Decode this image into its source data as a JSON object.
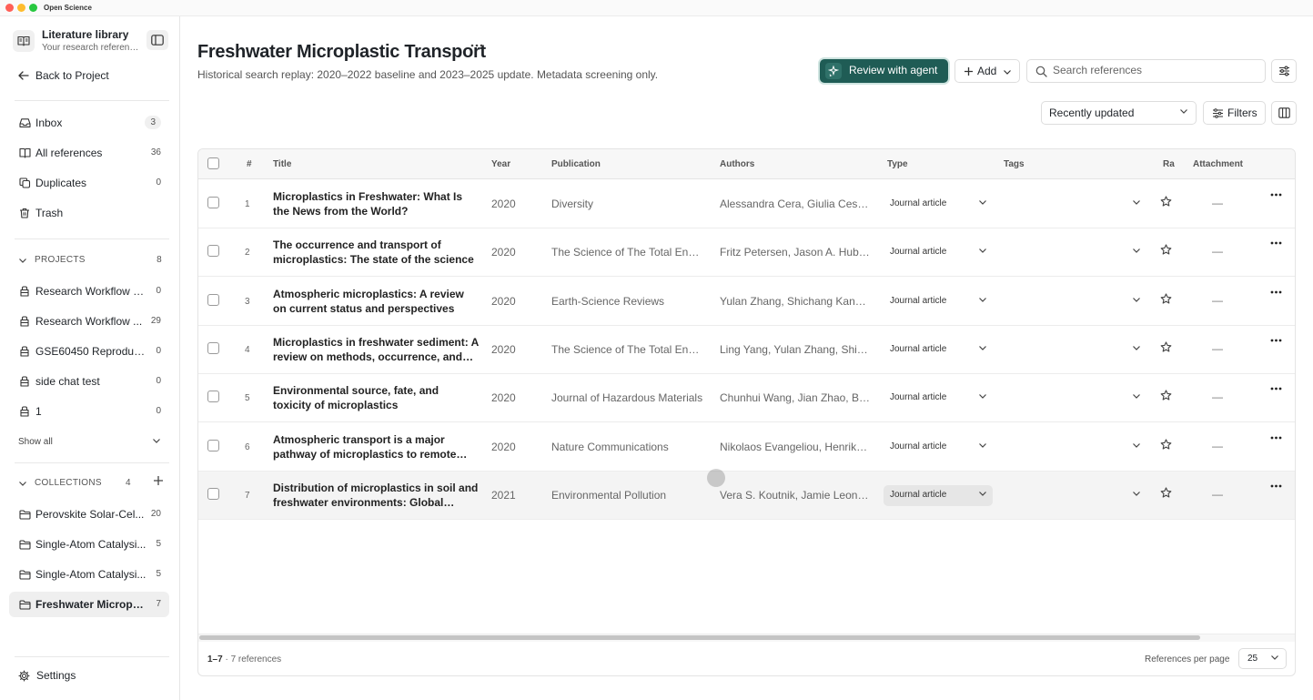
{
  "window": {
    "app_name": "Open Science"
  },
  "sidebar": {
    "library_title": "Literature library",
    "library_subtitle": "Your research references",
    "back_label": "Back to Project",
    "nav": [
      {
        "label": "Inbox",
        "count": "3",
        "icon": "inbox-icon"
      },
      {
        "label": "All references",
        "count": "36",
        "icon": "book-icon"
      },
      {
        "label": "Duplicates",
        "count": "0",
        "icon": "copy-icon"
      },
      {
        "label": "Trash",
        "count": "",
        "icon": "trash-icon"
      }
    ],
    "projects_header": "PROJECTS",
    "projects_count": "8",
    "projects": [
      {
        "label": "Research Workflow E...",
        "count": "0"
      },
      {
        "label": "Research Workflow ...",
        "count": "29"
      },
      {
        "label": "GSE60450 Reproduci...",
        "count": "0"
      },
      {
        "label": "side chat test",
        "count": "0"
      },
      {
        "label": "1",
        "count": "0"
      }
    ],
    "show_all": "Show all",
    "collections_header": "COLLECTIONS",
    "collections_count": "4",
    "collections": [
      {
        "label": "Perovskite Solar-Cel...",
        "count": "20"
      },
      {
        "label": "Single-Atom Catalysi...",
        "count": "5"
      },
      {
        "label": "Single-Atom Catalysi...",
        "count": "5"
      },
      {
        "label": "Freshwater Micropla...",
        "count": "7"
      }
    ],
    "settings_label": "Settings"
  },
  "header": {
    "title": "Freshwater Microplastic Transport",
    "description": "Historical search replay: 2020–2022 baseline and 2023–2025 update. Metadata screening only.",
    "agent_button": "Review with agent",
    "add_button": "Add",
    "search_placeholder": "Search references",
    "sort_value": "Recently updated",
    "filters_button": "Filters"
  },
  "table": {
    "columns": [
      "#",
      "Title",
      "Year",
      "Publication",
      "Authors",
      "Type",
      "Tags",
      "Ra",
      "Attachment"
    ],
    "rows": [
      {
        "num": "1",
        "title": "Microplastics in Freshwater: What Is the News from the World?",
        "year": "2020",
        "publication": "Diversity",
        "authors": "Alessandra Cera, Giulia Cesarini, Massimiliano Scalici",
        "type": "Journal article",
        "attachment": "—"
      },
      {
        "num": "2",
        "title": "The occurrence and transport of microplastics: The state of the science",
        "year": "2020",
        "publication": "The Science of The Total Environment",
        "authors": "Fritz Petersen, Jason A. Hubbart",
        "type": "Journal article",
        "attachment": "—"
      },
      {
        "num": "3",
        "title": "Atmospheric microplastics: A review on current status and perspectives",
        "year": "2020",
        "publication": "Earth-Science Reviews",
        "authors": "Yulan Zhang, Shichang Kang, Steve Allen",
        "type": "Journal article",
        "attachment": "—"
      },
      {
        "num": "4",
        "title": "Microplastics in freshwater sediment: A review on methods, occurrence, and sources",
        "year": "2020",
        "publication": "The Science of The Total Environment",
        "authors": "Ling Yang, Yulan Zhang, Shichang Kang",
        "type": "Journal article",
        "attachment": "—"
      },
      {
        "num": "5",
        "title": "Environmental source, fate, and toxicity of microplastics",
        "year": "2020",
        "publication": "Journal of Hazardous Materials",
        "authors": "Chunhui Wang, Jian Zhao, Baoshan Xing",
        "type": "Journal article",
        "attachment": "—"
      },
      {
        "num": "6",
        "title": "Atmospheric transport is a major pathway of microplastics to remote regions",
        "year": "2020",
        "publication": "Nature Communications",
        "authors": "Nikolaos Evangeliou, Henrik Grythe",
        "type": "Journal article",
        "attachment": "—"
      },
      {
        "num": "7",
        "title": "Distribution of microplastics in soil and freshwater environments: Global analysis",
        "year": "2021",
        "publication": "Environmental Pollution",
        "authors": "Vera S. Koutnik, Jamie Leonard",
        "type": "Journal article",
        "attachment": "—"
      }
    ],
    "footer_range": "1–7",
    "footer_total": "· 7 references",
    "per_page_label": "References per page",
    "per_page_value": "25"
  },
  "colors": {
    "accent": "#1f5c55",
    "selected_bg": "#efefef"
  }
}
